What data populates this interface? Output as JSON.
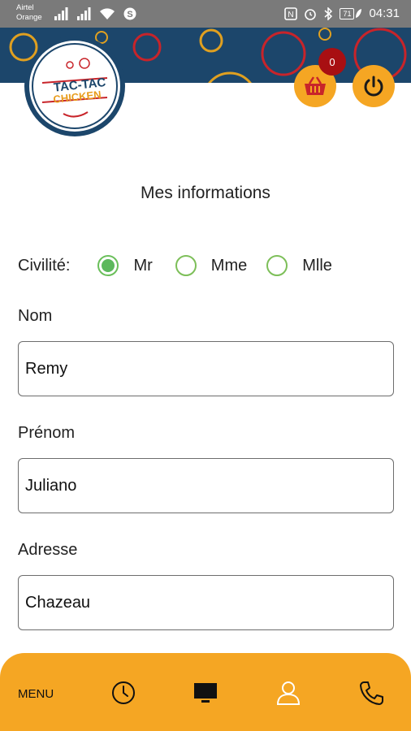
{
  "status_bar": {
    "carrier_line1": "Airtel",
    "carrier_line2": "Orange",
    "time": "04:31",
    "battery": "71"
  },
  "header": {
    "logo_text_line1": "TAC-TAC",
    "logo_text_line2": "CHICKEN",
    "cart_count": "0"
  },
  "page": {
    "title": "Mes informations"
  },
  "civility": {
    "label": "Civilité:",
    "options": [
      {
        "label": "Mr",
        "checked": true
      },
      {
        "label": "Mme",
        "checked": false
      },
      {
        "label": "Mlle",
        "checked": false
      }
    ]
  },
  "fields": {
    "nom": {
      "label": "Nom",
      "value": "Remy"
    },
    "prenom": {
      "label": "Prénom",
      "value": "Juliano"
    },
    "adresse": {
      "label": "Adresse",
      "value": "Chazeau"
    }
  },
  "bottom_nav": {
    "menu_label": "MENU",
    "icons": [
      "clock-icon",
      "monitor-icon",
      "user-icon",
      "phone-icon"
    ]
  },
  "colors": {
    "accent": "#f5a623",
    "banner": "#1c466b",
    "badge": "#a80f12",
    "radio": "#5cb85c"
  }
}
